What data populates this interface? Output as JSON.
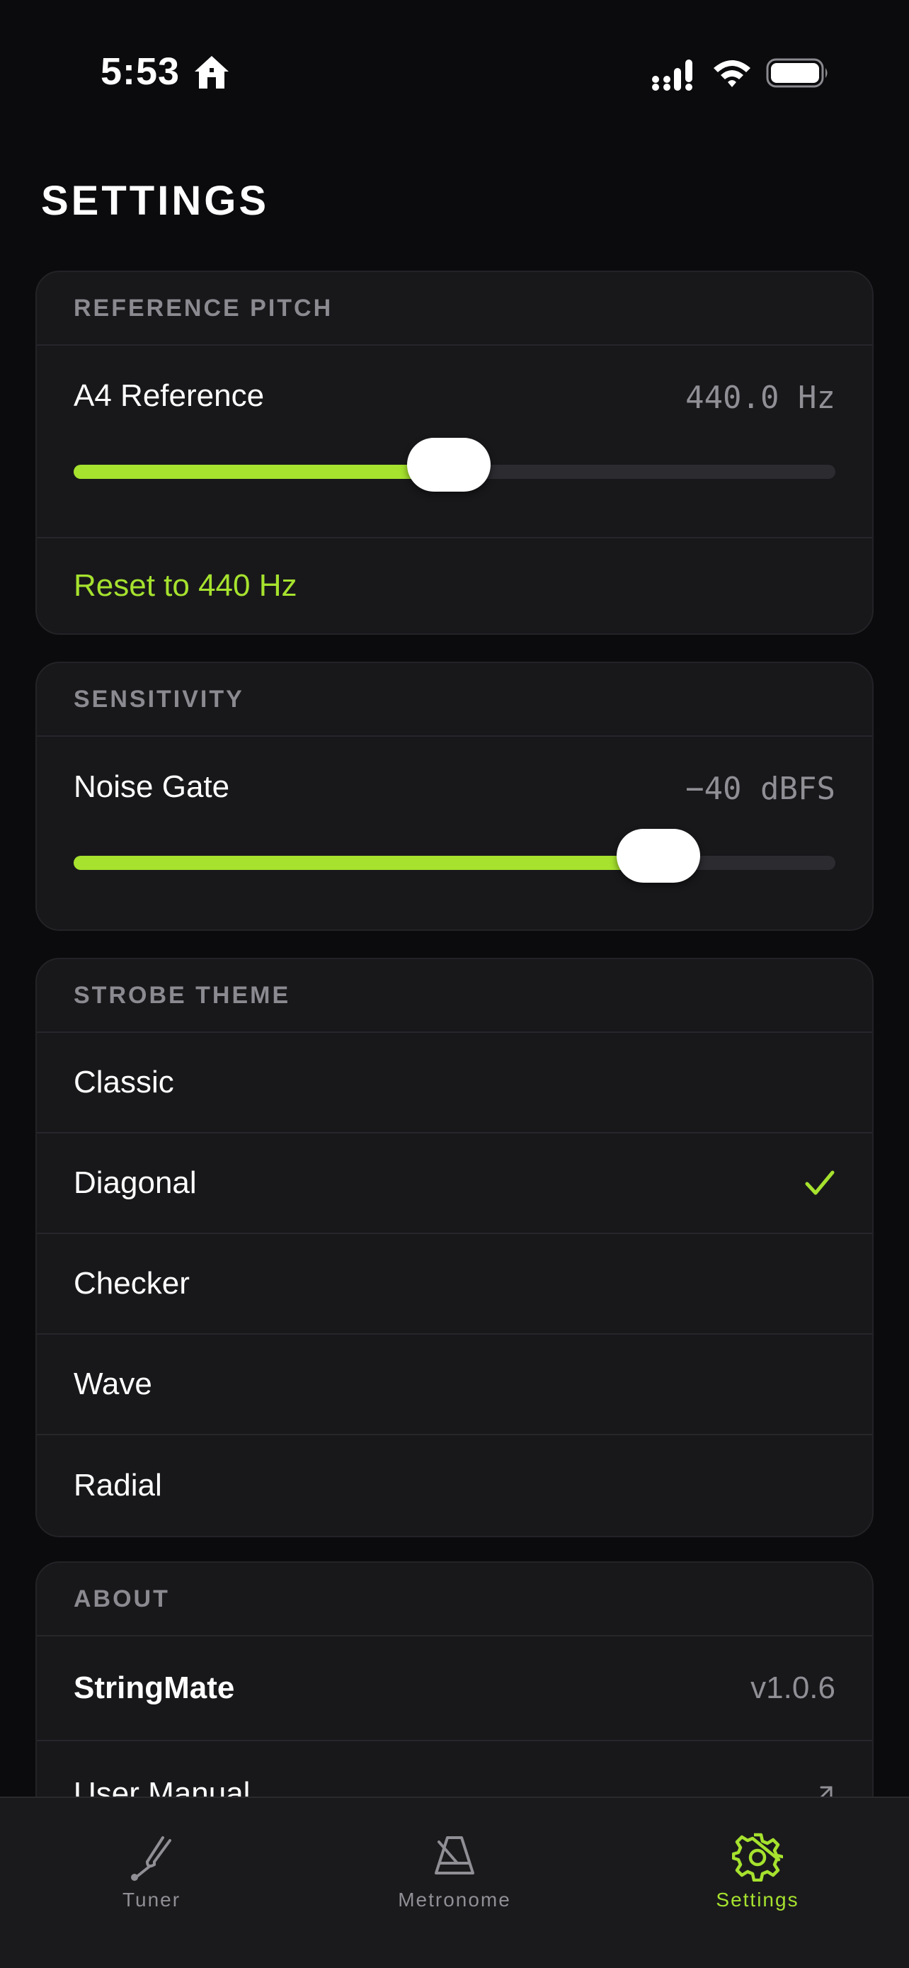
{
  "status_bar": {
    "time": "5:53"
  },
  "page": {
    "title": "SETTINGS"
  },
  "colors": {
    "accent": "#a6e22e",
    "background": "#0b0b0d",
    "card": "#18181b",
    "muted_text": "#8f8f95"
  },
  "reference_pitch": {
    "header": "REFERENCE PITCH",
    "label": "A4 Reference",
    "value": "440.0 Hz",
    "slider_fraction": 0.493,
    "reset_label": "Reset to 440 Hz"
  },
  "sensitivity": {
    "header": "SENSITIVITY",
    "label": "Noise Gate",
    "value": "−40 dBFS",
    "slider_fraction": 0.768
  },
  "strobe_theme": {
    "header": "STROBE THEME",
    "options": [
      "Classic",
      "Diagonal",
      "Checker",
      "Wave",
      "Radial"
    ],
    "selected": "Diagonal"
  },
  "about": {
    "header": "ABOUT",
    "app_name": "StringMate",
    "version": "v1.0.6",
    "manual_label": "User Manual"
  },
  "tab_bar": {
    "tabs": [
      {
        "label": "Tuner",
        "icon": "tuning-fork-icon"
      },
      {
        "label": "Metronome",
        "icon": "metronome-icon"
      },
      {
        "label": "Settings",
        "icon": "gear-icon"
      }
    ],
    "active": "Settings"
  }
}
